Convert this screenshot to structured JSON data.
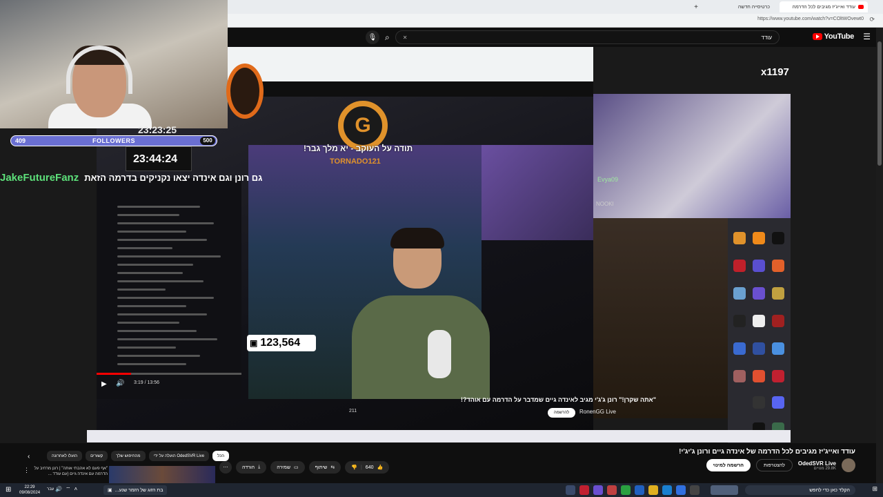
{
  "browser": {
    "active_tab": "עודד ואייג'יז מגיבים לכל הדרמה",
    "new_tab": "כרטיסייה חדשה",
    "new_tab_plus": "+",
    "url": "https://www.youtube.com/watch?v=COltWOvewt0"
  },
  "yt": {
    "logo": "YouTube",
    "search_value": "עודד"
  },
  "overlay": {
    "followers_current": "409",
    "followers_label": "FOLLOWERS",
    "followers_goal": "500",
    "timer_top": "23:23:25",
    "timer_box": "23:44:24",
    "chat_user": "JakeFutureFanz",
    "chat_message": "גם רונן וגם אינדה יצאו נקניקים בדרמה הזאת",
    "thanks_text": "תודה על העוקב - יא מלך גבר!",
    "logo_letter": "G",
    "tornado_name": "TORNADO121",
    "view_count": "123,564",
    "x_count": "x1197",
    "evya": "Evya09",
    "nooki": "NOOKI",
    "time_text": "3:19 / 13:56",
    "inner_caption": "\"אתה שקרן!\" רונן ג'ג'י מגיב לאינדה גיים שמדבר על הדרמה עם אוהד?!",
    "inner_channel": "RonenGG Live",
    "inner_subscribe": "להרשמה",
    "inner_likes": "211"
  },
  "video_info": {
    "title": "עודד ואייג'יז מגיבים לכל הדרמה של אינדה גיים ורונן ג'יג'י!",
    "channel_name": "OdedSVR Live",
    "subscribers": "29.8K מנויים",
    "join_label": "להצטרפות",
    "subscribe_label": "הרשמה למינוי",
    "likes": "640",
    "share_label": "שיתוף",
    "save_label": "שמירה",
    "download_label": "הורדה"
  },
  "chips": [
    "הכל",
    "הועלה על ידי OdedSVR Live",
    "מהחיפוש שלך",
    "קשורים",
    "הועלו לאחרונה"
  ],
  "recommended": {
    "title": "\"אף פעם לא אהבתי אותה\" | רונן מרחיב על הדרמה עם אינדה גיים (עם עודד ..."
  },
  "taskbar": {
    "time": "22:29",
    "date": "09/08/2024",
    "lang": "עבר",
    "window_title": "בת הזוג של הזמר שנע...",
    "search_placeholder": "הקלד כאן כדי לחפש"
  },
  "colors": {
    "youtube_red": "#ff0000",
    "followers_bar": "#6a6fd2",
    "chat_user": "#5de07a",
    "brand_orange": "#e0922b"
  }
}
